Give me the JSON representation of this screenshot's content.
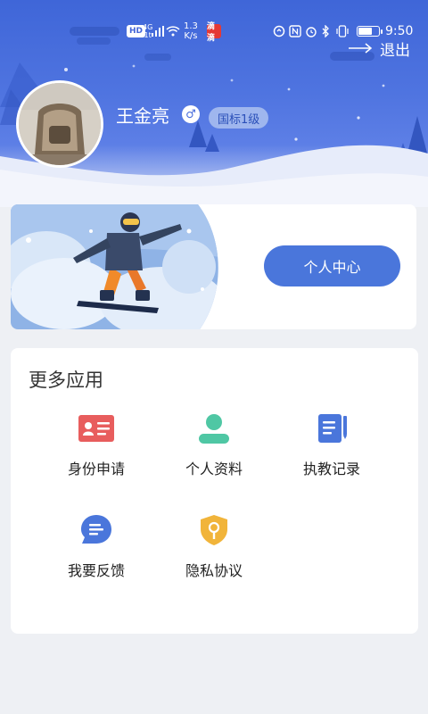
{
  "status_bar": {
    "hd_label": "HD",
    "net_type_top": "4G",
    "net_type_bottom": "1t",
    "net_speed_value": "1.3",
    "net_speed_unit": "K/s",
    "notification_label": "滴滴",
    "time": "9:50",
    "battery_level": 0.7
  },
  "header": {
    "logout_label": "退出",
    "username": "王金亮",
    "gender_symbol": "♂",
    "level_badge": "国标1级"
  },
  "banner": {
    "personal_center_label": "个人中心"
  },
  "more_apps": {
    "title": "更多应用",
    "items": [
      {
        "label": "身份申请",
        "icon": "id-card-icon",
        "color": "#e85d5d"
      },
      {
        "label": "个人资料",
        "icon": "profile-icon",
        "color": "#4fc7a4"
      },
      {
        "label": "执教记录",
        "icon": "record-icon",
        "color": "#4a76db"
      },
      {
        "label": "我要反馈",
        "icon": "feedback-icon",
        "color": "#4a76db"
      },
      {
        "label": "隐私协议",
        "icon": "privacy-icon",
        "color": "#f1b43a"
      }
    ]
  },
  "colors": {
    "header_blue": "#4469da",
    "accent_blue": "#4a76db",
    "page_bg": "#eef0f4"
  }
}
